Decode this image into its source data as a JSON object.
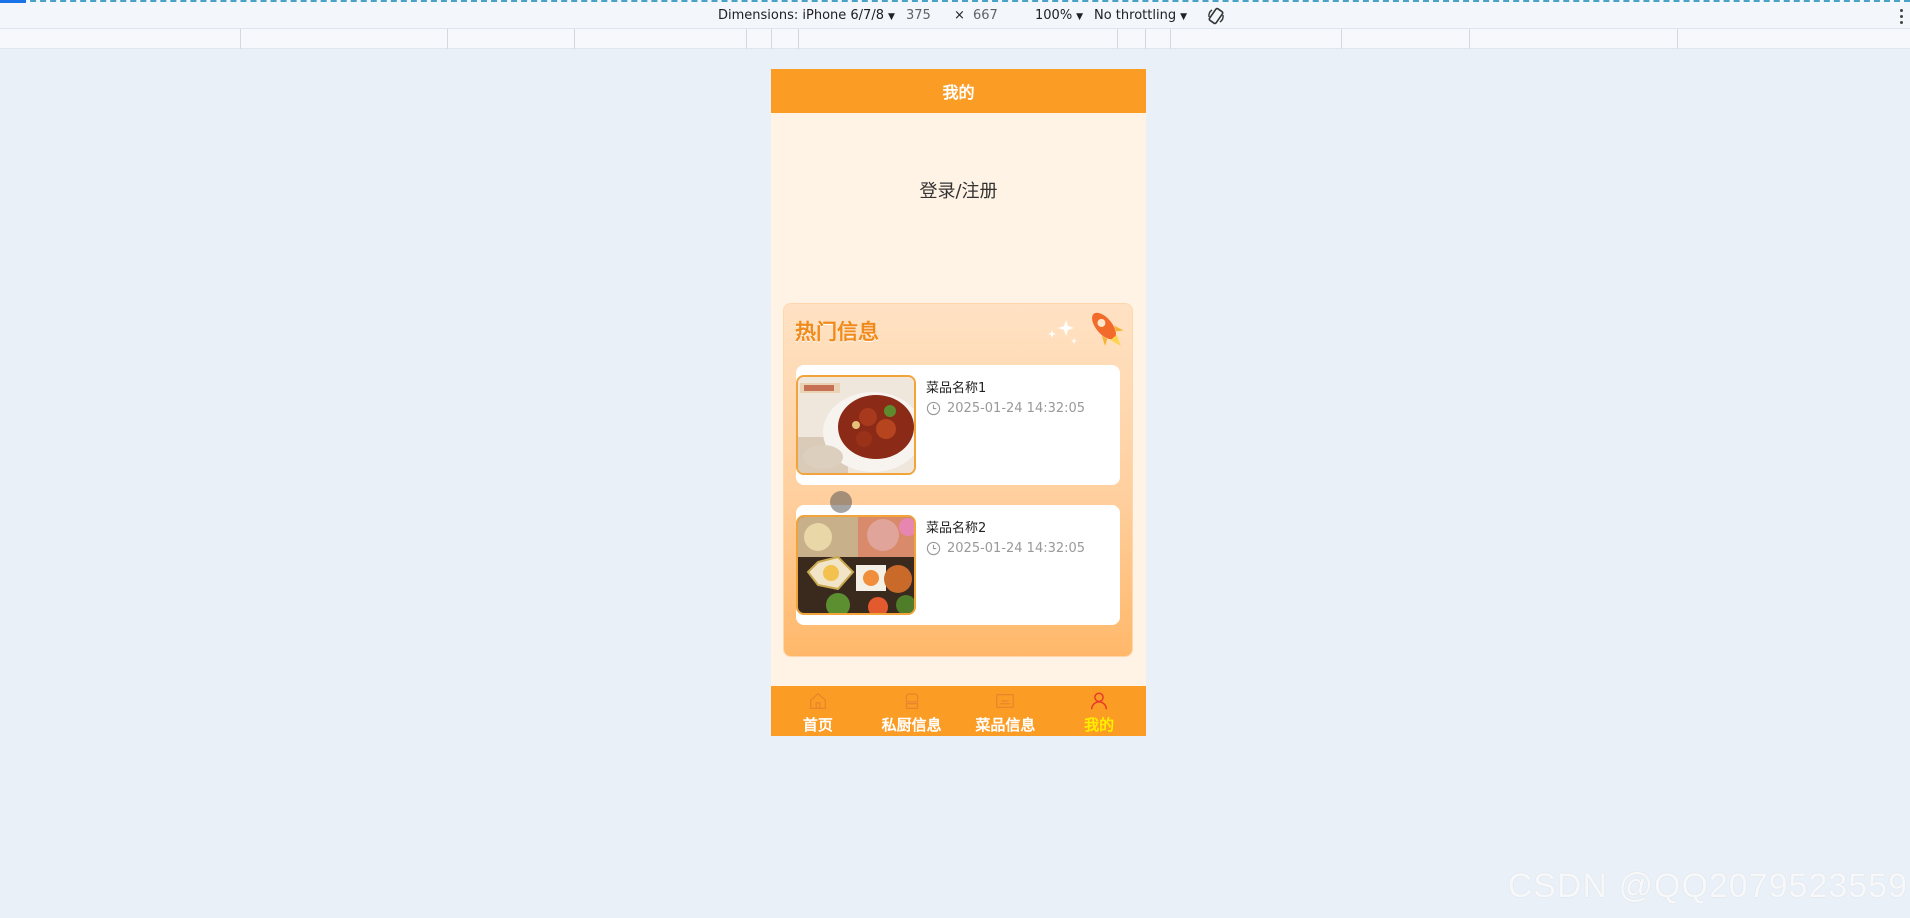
{
  "devtools": {
    "dimensions_label": "Dimensions: iPhone 6/7/8",
    "width": "375",
    "times": "×",
    "height": "667",
    "zoom": "100%",
    "throttling": "No throttling"
  },
  "app": {
    "header_title": "我的",
    "login_text": "登录/注册",
    "hot_title": "热门信息",
    "items": [
      {
        "name": "菜品名称1",
        "time": "2025-01-24 14:32:05"
      },
      {
        "name": "菜品名称2",
        "time": "2025-01-24 14:32:05"
      }
    ],
    "tabs": [
      {
        "label": "首页",
        "icon": "home-icon"
      },
      {
        "label": "私厨信息",
        "icon": "chef-icon"
      },
      {
        "label": "菜品信息",
        "icon": "dish-icon"
      },
      {
        "label": "我的",
        "icon": "user-icon",
        "active": true
      }
    ]
  },
  "watermark": "CSDN @QQ2079523559",
  "colors": {
    "primary": "#fb9c25",
    "active_tab": "#ffee00",
    "hot_title": "#f08a1a"
  }
}
